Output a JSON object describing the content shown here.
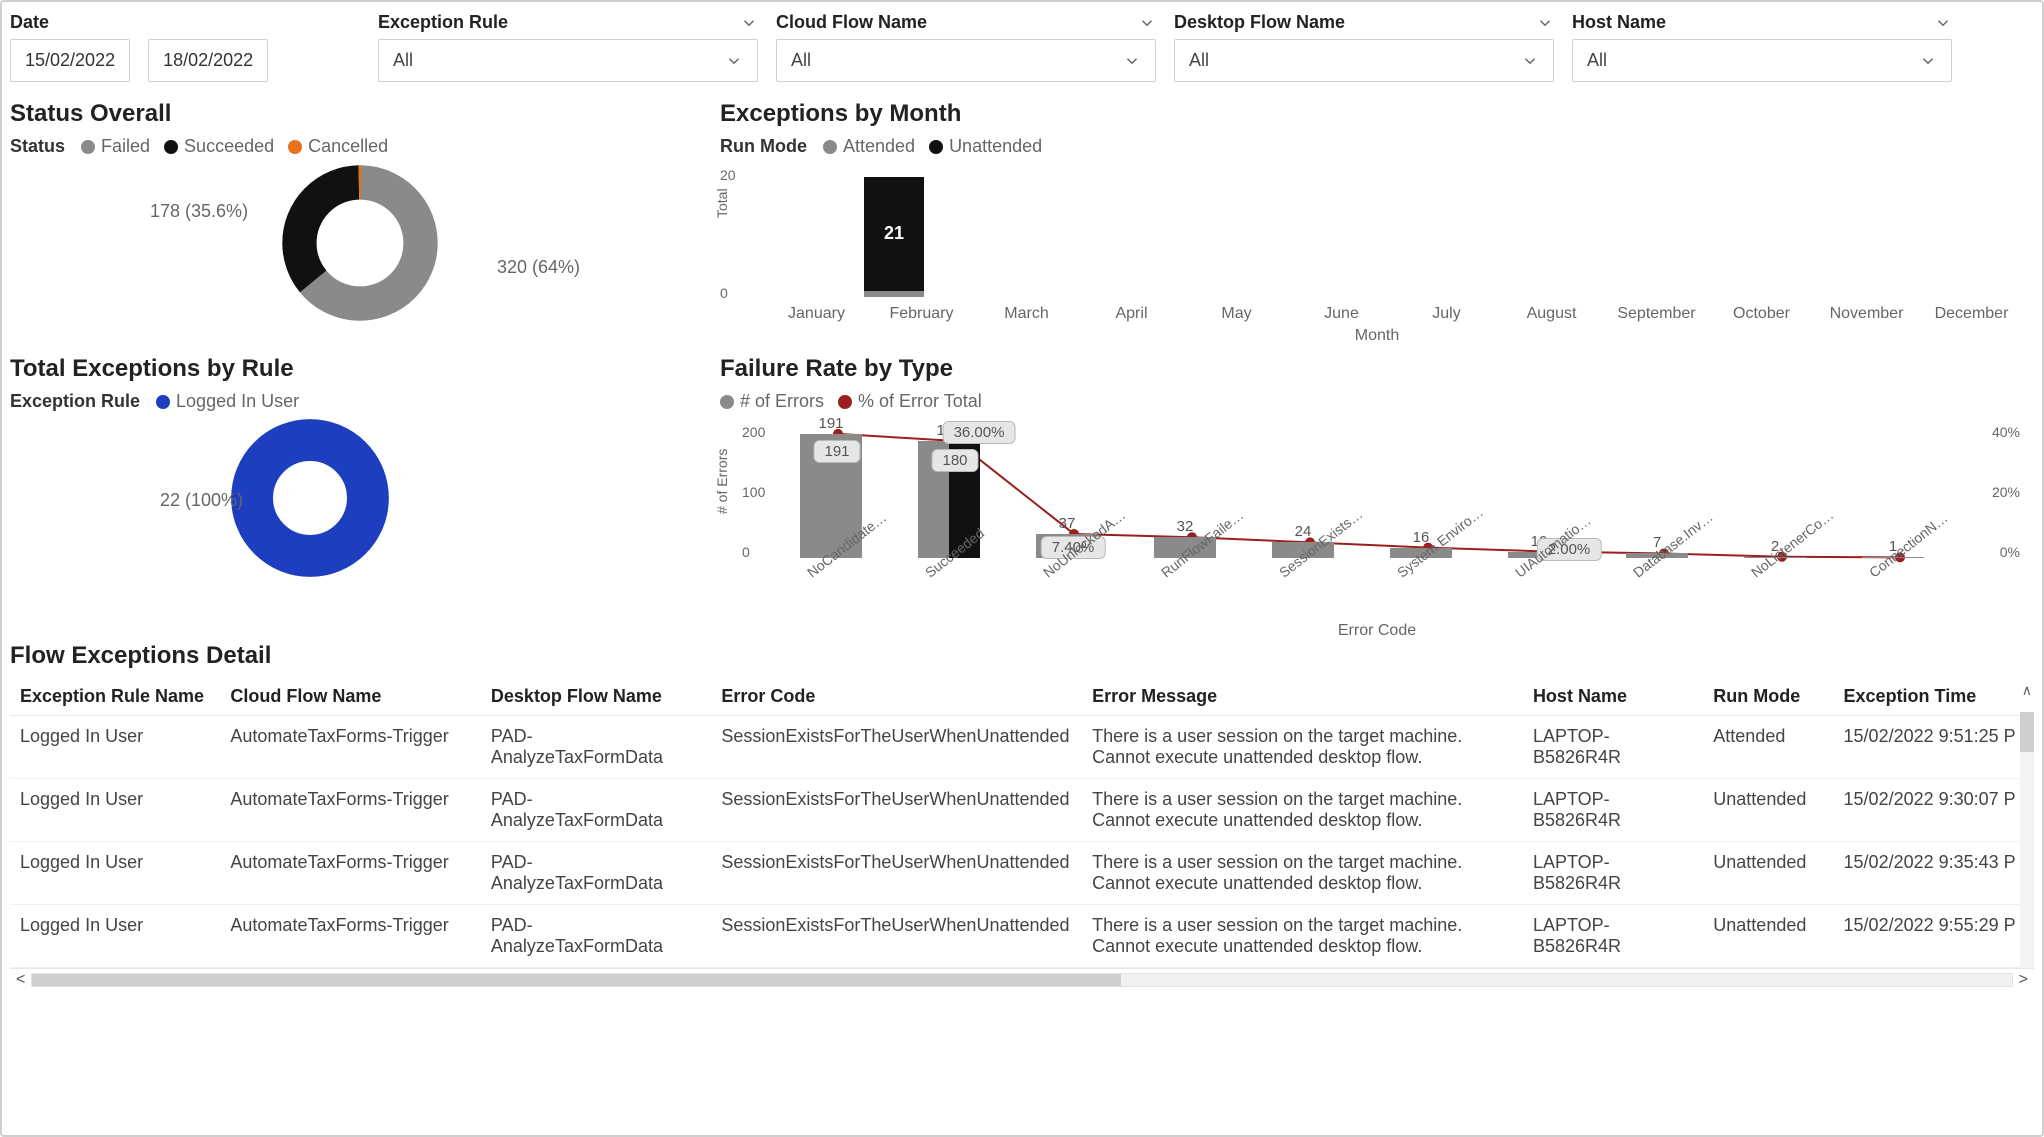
{
  "filters": {
    "date_label": "Date",
    "date_from": "15/02/2022",
    "date_to": "18/02/2022",
    "exception_rule": {
      "label": "Exception Rule",
      "value": "All"
    },
    "cloud_flow": {
      "label": "Cloud Flow Name",
      "value": "All"
    },
    "desktop_flow": {
      "label": "Desktop Flow Name",
      "value": "All"
    },
    "host": {
      "label": "Host Name",
      "value": "All"
    }
  },
  "status_overall": {
    "title": "Status Overall",
    "legend_title": "Status",
    "legend": [
      "Failed",
      "Succeeded",
      "Cancelled"
    ],
    "colors": [
      "#8a8a8a",
      "#111111",
      "#e8711c"
    ],
    "label_left": "178 (35.6%)",
    "label_right": "320 (64%)"
  },
  "exc_by_month": {
    "title": "Exceptions by Month",
    "legend_title": "Run Mode",
    "legend": [
      "Attended",
      "Unattended"
    ],
    "colors": [
      "#8a8a8a",
      "#111111"
    ],
    "y_title": "Total",
    "x_title": "Month",
    "months": [
      "January",
      "February",
      "March",
      "April",
      "May",
      "June",
      "July",
      "August",
      "September",
      "October",
      "November",
      "December"
    ],
    "feb_total_label": "21"
  },
  "exc_by_rule": {
    "title": "Total Exceptions by Rule",
    "legend_title": "Exception Rule",
    "legend_item": "Logged In User",
    "color": "#1d3fbf",
    "label": "22 (100%)"
  },
  "failure_rate": {
    "title": "Failure Rate by Type",
    "legend": [
      "# of Errors",
      "% of Error Total"
    ],
    "colors": [
      "#8a8a8a",
      "#9c1f1f"
    ],
    "y_left_title": "# of Errors",
    "x_title": "Error Code",
    "y_left_ticks": [
      "200",
      "100",
      "0"
    ],
    "y_right_ticks": [
      "40%",
      "20%",
      "0%"
    ],
    "callouts": {
      "c1": "191",
      "c2": "36.00%",
      "c3": "180",
      "c4": "7.40%",
      "c5": "2.00%"
    },
    "bars": [
      {
        "label": "NoCandidate…",
        "v": "191"
      },
      {
        "label": "Succeeded",
        "v": "180"
      },
      {
        "label": "NoUnlockedA…",
        "v": "37"
      },
      {
        "label": "RunFlowFaile…",
        "v": "32"
      },
      {
        "label": "SessionExists…",
        "v": "24"
      },
      {
        "label": "System.Enviro…",
        "v": "16"
      },
      {
        "label": "UIAutomatio…",
        "v": "10"
      },
      {
        "label": "Database.Inv…",
        "v": "7"
      },
      {
        "label": "NoListenerCo…",
        "v": "2"
      },
      {
        "label": "ConnectionN…",
        "v": "1"
      }
    ]
  },
  "detail": {
    "title": "Flow Exceptions Detail",
    "cols": [
      "Exception Rule Name",
      "Cloud Flow Name",
      "Desktop Flow Name",
      "Error Code",
      "Error Message",
      "Host Name",
      "Run Mode",
      "Exception Time"
    ],
    "rows": [
      [
        "Logged In User",
        "AutomateTaxForms-Trigger",
        "PAD-AnalyzeTaxFormData",
        "SessionExistsForTheUserWhenUnattended",
        "There is a user session on the target machine. Cannot execute unattended desktop flow.",
        "LAPTOP-B5826R4R",
        "Attended",
        "15/02/2022 9:51:25 P"
      ],
      [
        "Logged In User",
        "AutomateTaxForms-Trigger",
        "PAD-AnalyzeTaxFormData",
        "SessionExistsForTheUserWhenUnattended",
        "There is a user session on the target machine. Cannot execute unattended desktop flow.",
        "LAPTOP-B5826R4R",
        "Unattended",
        "15/02/2022 9:30:07 P"
      ],
      [
        "Logged In User",
        "AutomateTaxForms-Trigger",
        "PAD-AnalyzeTaxFormData",
        "SessionExistsForTheUserWhenUnattended",
        "There is a user session on the target machine. Cannot execute unattended desktop flow.",
        "LAPTOP-B5826R4R",
        "Unattended",
        "15/02/2022 9:35:43 P"
      ],
      [
        "Logged In User",
        "AutomateTaxForms-Trigger",
        "PAD-AnalyzeTaxFormData",
        "SessionExistsForTheUserWhenUnattended",
        "There is a user session on the target machine. Cannot execute unattended desktop flow.",
        "LAPTOP-B5826R4R",
        "Unattended",
        "15/02/2022 9:55:29 P"
      ]
    ]
  },
  "chart_data": [
    {
      "type": "pie",
      "title": "Status Overall",
      "series": [
        {
          "name": "Failed",
          "value": 320,
          "pct": 64.0,
          "color": "#8a8a8a"
        },
        {
          "name": "Succeeded",
          "value": 178,
          "pct": 35.6,
          "color": "#111111"
        },
        {
          "name": "Cancelled",
          "value": 2,
          "pct": 0.4,
          "color": "#e8711c"
        }
      ]
    },
    {
      "type": "bar",
      "title": "Exceptions by Month",
      "xlabel": "Month",
      "ylabel": "Total",
      "ylim": [
        0,
        20
      ],
      "categories": [
        "January",
        "February",
        "March",
        "April",
        "May",
        "June",
        "July",
        "August",
        "September",
        "October",
        "November",
        "December"
      ],
      "series": [
        {
          "name": "Attended",
          "color": "#8a8a8a",
          "values": [
            0,
            1,
            0,
            0,
            0,
            0,
            0,
            0,
            0,
            0,
            0,
            0
          ]
        },
        {
          "name": "Unattended",
          "color": "#111111",
          "values": [
            0,
            20,
            0,
            0,
            0,
            0,
            0,
            0,
            0,
            0,
            0,
            0
          ]
        }
      ],
      "annotations": {
        "February_total": 21
      }
    },
    {
      "type": "pie",
      "title": "Total Exceptions by Rule",
      "series": [
        {
          "name": "Logged In User",
          "value": 22,
          "pct": 100.0,
          "color": "#1d3fbf"
        }
      ]
    },
    {
      "type": "bar",
      "title": "Failure Rate by Type",
      "xlabel": "Error Code",
      "ylabel": "# of Errors",
      "ylim": [
        0,
        200
      ],
      "y2label": "% of Error Total",
      "y2lim": [
        0,
        40
      ],
      "categories": [
        "NoCandidate…",
        "Succeeded",
        "NoUnlockedA…",
        "RunFlowFaile…",
        "SessionExists…",
        "System.Enviro…",
        "UIAutomatio…",
        "Database.Inv…",
        "NoListenerCo…",
        "ConnectionN…"
      ],
      "series": [
        {
          "name": "# of Errors",
          "type": "bar",
          "color": "#8a8a8a",
          "values": [
            191,
            180,
            37,
            32,
            24,
            16,
            10,
            7,
            2,
            1
          ]
        },
        {
          "name": "% of Error Total",
          "type": "line",
          "color": "#9c1f1f",
          "values": [
            38.2,
            36.0,
            7.4,
            6.4,
            4.8,
            3.2,
            2.0,
            1.4,
            0.4,
            0.2
          ]
        }
      ]
    }
  ]
}
